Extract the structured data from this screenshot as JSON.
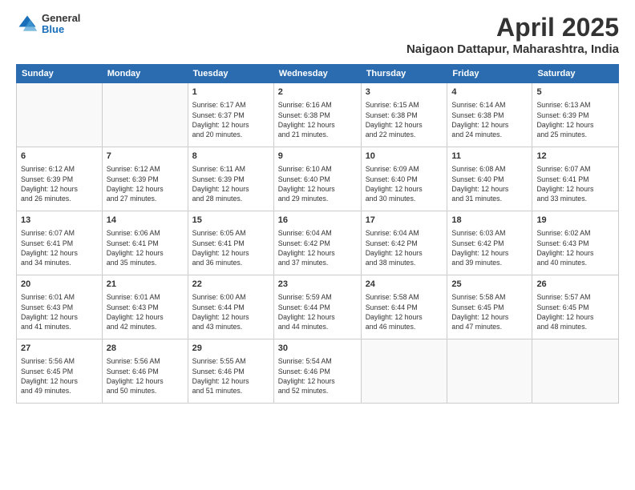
{
  "header": {
    "logo": {
      "line1": "General",
      "line2": "Blue"
    },
    "title": "April 2025",
    "subtitle": "Naigaon Dattapur, Maharashtra, India"
  },
  "calendar": {
    "days_of_week": [
      "Sunday",
      "Monday",
      "Tuesday",
      "Wednesday",
      "Thursday",
      "Friday",
      "Saturday"
    ],
    "weeks": [
      [
        {
          "day": "",
          "info": ""
        },
        {
          "day": "",
          "info": ""
        },
        {
          "day": "1",
          "info": "Sunrise: 6:17 AM\nSunset: 6:37 PM\nDaylight: 12 hours\nand 20 minutes."
        },
        {
          "day": "2",
          "info": "Sunrise: 6:16 AM\nSunset: 6:38 PM\nDaylight: 12 hours\nand 21 minutes."
        },
        {
          "day": "3",
          "info": "Sunrise: 6:15 AM\nSunset: 6:38 PM\nDaylight: 12 hours\nand 22 minutes."
        },
        {
          "day": "4",
          "info": "Sunrise: 6:14 AM\nSunset: 6:38 PM\nDaylight: 12 hours\nand 24 minutes."
        },
        {
          "day": "5",
          "info": "Sunrise: 6:13 AM\nSunset: 6:39 PM\nDaylight: 12 hours\nand 25 minutes."
        }
      ],
      [
        {
          "day": "6",
          "info": "Sunrise: 6:12 AM\nSunset: 6:39 PM\nDaylight: 12 hours\nand 26 minutes."
        },
        {
          "day": "7",
          "info": "Sunrise: 6:12 AM\nSunset: 6:39 PM\nDaylight: 12 hours\nand 27 minutes."
        },
        {
          "day": "8",
          "info": "Sunrise: 6:11 AM\nSunset: 6:39 PM\nDaylight: 12 hours\nand 28 minutes."
        },
        {
          "day": "9",
          "info": "Sunrise: 6:10 AM\nSunset: 6:40 PM\nDaylight: 12 hours\nand 29 minutes."
        },
        {
          "day": "10",
          "info": "Sunrise: 6:09 AM\nSunset: 6:40 PM\nDaylight: 12 hours\nand 30 minutes."
        },
        {
          "day": "11",
          "info": "Sunrise: 6:08 AM\nSunset: 6:40 PM\nDaylight: 12 hours\nand 31 minutes."
        },
        {
          "day": "12",
          "info": "Sunrise: 6:07 AM\nSunset: 6:41 PM\nDaylight: 12 hours\nand 33 minutes."
        }
      ],
      [
        {
          "day": "13",
          "info": "Sunrise: 6:07 AM\nSunset: 6:41 PM\nDaylight: 12 hours\nand 34 minutes."
        },
        {
          "day": "14",
          "info": "Sunrise: 6:06 AM\nSunset: 6:41 PM\nDaylight: 12 hours\nand 35 minutes."
        },
        {
          "day": "15",
          "info": "Sunrise: 6:05 AM\nSunset: 6:41 PM\nDaylight: 12 hours\nand 36 minutes."
        },
        {
          "day": "16",
          "info": "Sunrise: 6:04 AM\nSunset: 6:42 PM\nDaylight: 12 hours\nand 37 minutes."
        },
        {
          "day": "17",
          "info": "Sunrise: 6:04 AM\nSunset: 6:42 PM\nDaylight: 12 hours\nand 38 minutes."
        },
        {
          "day": "18",
          "info": "Sunrise: 6:03 AM\nSunset: 6:42 PM\nDaylight: 12 hours\nand 39 minutes."
        },
        {
          "day": "19",
          "info": "Sunrise: 6:02 AM\nSunset: 6:43 PM\nDaylight: 12 hours\nand 40 minutes."
        }
      ],
      [
        {
          "day": "20",
          "info": "Sunrise: 6:01 AM\nSunset: 6:43 PM\nDaylight: 12 hours\nand 41 minutes."
        },
        {
          "day": "21",
          "info": "Sunrise: 6:01 AM\nSunset: 6:43 PM\nDaylight: 12 hours\nand 42 minutes."
        },
        {
          "day": "22",
          "info": "Sunrise: 6:00 AM\nSunset: 6:44 PM\nDaylight: 12 hours\nand 43 minutes."
        },
        {
          "day": "23",
          "info": "Sunrise: 5:59 AM\nSunset: 6:44 PM\nDaylight: 12 hours\nand 44 minutes."
        },
        {
          "day": "24",
          "info": "Sunrise: 5:58 AM\nSunset: 6:44 PM\nDaylight: 12 hours\nand 46 minutes."
        },
        {
          "day": "25",
          "info": "Sunrise: 5:58 AM\nSunset: 6:45 PM\nDaylight: 12 hours\nand 47 minutes."
        },
        {
          "day": "26",
          "info": "Sunrise: 5:57 AM\nSunset: 6:45 PM\nDaylight: 12 hours\nand 48 minutes."
        }
      ],
      [
        {
          "day": "27",
          "info": "Sunrise: 5:56 AM\nSunset: 6:45 PM\nDaylight: 12 hours\nand 49 minutes."
        },
        {
          "day": "28",
          "info": "Sunrise: 5:56 AM\nSunset: 6:46 PM\nDaylight: 12 hours\nand 50 minutes."
        },
        {
          "day": "29",
          "info": "Sunrise: 5:55 AM\nSunset: 6:46 PM\nDaylight: 12 hours\nand 51 minutes."
        },
        {
          "day": "30",
          "info": "Sunrise: 5:54 AM\nSunset: 6:46 PM\nDaylight: 12 hours\nand 52 minutes."
        },
        {
          "day": "",
          "info": ""
        },
        {
          "day": "",
          "info": ""
        },
        {
          "day": "",
          "info": ""
        }
      ]
    ]
  }
}
